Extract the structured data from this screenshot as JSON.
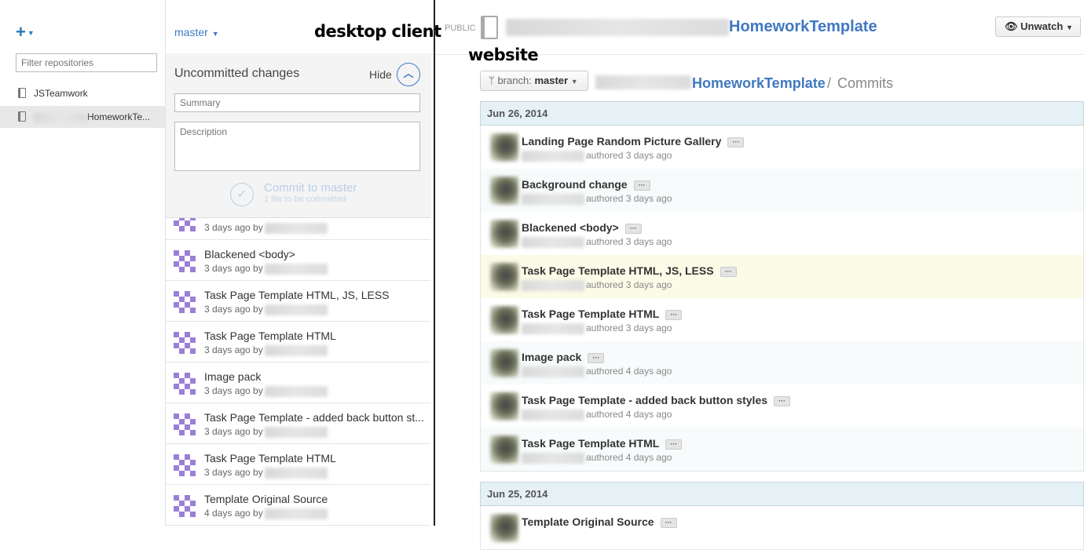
{
  "desktop_client": {
    "annotation": "desktop client",
    "add_icon": "+",
    "filter_placeholder": "Filter repositories",
    "repos": [
      {
        "name": "JSTeamwork",
        "selected": false
      },
      {
        "name": "HomeworkTe...",
        "selected": true
      }
    ],
    "branch": "master",
    "uncommitted_title": "Uncommitted changes",
    "hide_label": "Hide",
    "summary_placeholder": "Summary",
    "description_placeholder": "Description",
    "commit_button": "Commit to master",
    "commit_sub": "1 file to be committed",
    "history": [
      {
        "title": "",
        "meta": "3 days ago by"
      },
      {
        "title": "Blackened <body>",
        "meta": "3 days ago by"
      },
      {
        "title": "Task Page Template HTML, JS, LESS",
        "meta": "3 days ago by"
      },
      {
        "title": "Task Page Template HTML",
        "meta": "3 days ago by"
      },
      {
        "title": "Image pack",
        "meta": "3 days ago by"
      },
      {
        "title": "Task Page Template - added back button st...",
        "meta": "3 days ago by"
      },
      {
        "title": "Task Page Template HTML",
        "meta": "3 days ago by"
      },
      {
        "title": "Template Original Source",
        "meta": "4 days ago by"
      }
    ]
  },
  "website": {
    "annotation": "website",
    "public_label": "PUBLIC",
    "repo_name": "HomeworkTemplate",
    "unwatch_label": "Unwatch",
    "branch_label": "branch:",
    "branch_value": "master",
    "crumb_repo": "HomeworkTemplate",
    "crumb_sep": "/",
    "crumb_page": "Commits",
    "days": [
      {
        "date": "Jun 26, 2014",
        "commits": [
          {
            "title": "Landing Page Random Picture Gallery",
            "meta": "authored 3 days ago"
          },
          {
            "title": "Background change",
            "meta": "authored 3 days ago"
          },
          {
            "title": "Blackened <body>",
            "meta": "authored 3 days ago"
          },
          {
            "title": "Task Page Template HTML, JS, LESS",
            "meta": "authored 3 days ago",
            "highlight": true
          },
          {
            "title": "Task Page Template HTML",
            "meta": "authored 3 days ago"
          },
          {
            "title": "Image pack",
            "meta": "authored 4 days ago"
          },
          {
            "title": "Task Page Template - added back button styles",
            "meta": "authored 4 days ago"
          },
          {
            "title": "Task Page Template HTML",
            "meta": "authored 4 days ago"
          }
        ]
      },
      {
        "date": "Jun 25, 2014",
        "commits": [
          {
            "title": "Template Original Source",
            "meta": ""
          }
        ]
      }
    ],
    "ellipsis": "···"
  }
}
